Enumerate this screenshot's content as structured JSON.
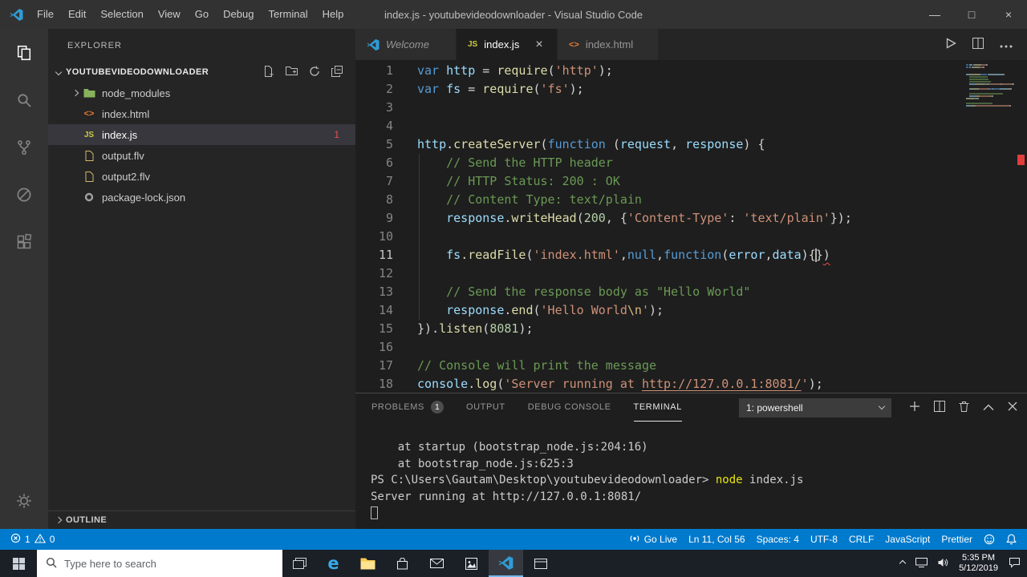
{
  "title_bar": {
    "title": "index.js - youtubevideodownloader - Visual Studio Code",
    "menus": [
      "File",
      "Edit",
      "Selection",
      "View",
      "Go",
      "Debug",
      "Terminal",
      "Help"
    ],
    "controls": {
      "minimize": "—",
      "maximize": "□",
      "close": "×"
    }
  },
  "activity_bar": {
    "views": [
      "explorer",
      "search",
      "source-control",
      "debug",
      "extensions"
    ],
    "active_view": "explorer",
    "bottom": [
      "settings"
    ]
  },
  "sidebar": {
    "title": "EXPLORER",
    "root_folder": "YOUTUBEVIDEODOWNLOADER",
    "files": [
      {
        "label": "node_modules",
        "icon": "folder",
        "chevron": true
      },
      {
        "label": "index.html",
        "icon": "html"
      },
      {
        "label": "index.js",
        "icon": "js",
        "selected": true,
        "badge": "1"
      },
      {
        "label": "output.flv",
        "icon": "file"
      },
      {
        "label": "output2.flv",
        "icon": "file"
      },
      {
        "label": "package-lock.json",
        "icon": "lock"
      }
    ],
    "outline_label": "OUTLINE"
  },
  "tabs": [
    {
      "label": "Welcome",
      "icon": "vscode",
      "preview": true
    },
    {
      "label": "index.js",
      "icon": "js",
      "active": true,
      "closable": true
    },
    {
      "label": "index.html",
      "icon": "html"
    }
  ],
  "editor": {
    "active_line": 11,
    "lines": [
      [
        [
          "kw",
          "var"
        ],
        [
          "pun",
          " "
        ],
        [
          "vr",
          "http"
        ],
        [
          "pun",
          " = "
        ],
        [
          "fn",
          "require"
        ],
        [
          "pun",
          "("
        ],
        [
          "str",
          "'http'"
        ],
        [
          "pun",
          ");"
        ]
      ],
      [
        [
          "kw",
          "var"
        ],
        [
          "pun",
          " "
        ],
        [
          "vr",
          "fs"
        ],
        [
          "pun",
          " = "
        ],
        [
          "fn",
          "require"
        ],
        [
          "pun",
          "("
        ],
        [
          "str",
          "'fs'"
        ],
        [
          "pun",
          ");"
        ]
      ],
      [],
      [],
      [
        [
          "vr",
          "http"
        ],
        [
          "pun",
          "."
        ],
        [
          "fn",
          "createServer"
        ],
        [
          "pun",
          "("
        ],
        [
          "kw",
          "function"
        ],
        [
          "pun",
          " ("
        ],
        [
          "vr",
          "request"
        ],
        [
          "pun",
          ", "
        ],
        [
          "vr",
          "response"
        ],
        [
          "pun",
          ") {"
        ]
      ],
      [
        [
          "cmt",
          "    // Send the HTTP header"
        ]
      ],
      [
        [
          "cmt",
          "    // HTTP Status: 200 : OK"
        ]
      ],
      [
        [
          "cmt",
          "    // Content Type: text/plain"
        ]
      ],
      [
        [
          "pun",
          "    "
        ],
        [
          "vr",
          "response"
        ],
        [
          "pun",
          "."
        ],
        [
          "fn",
          "writeHead"
        ],
        [
          "pun",
          "("
        ],
        [
          "num",
          "200"
        ],
        [
          "pun",
          ", {"
        ],
        [
          "str",
          "'Content-Type'"
        ],
        [
          "pun",
          ": "
        ],
        [
          "str",
          "'text/plain'"
        ],
        [
          "pun",
          "});"
        ]
      ],
      [],
      [
        [
          "pun",
          "    "
        ],
        [
          "vr",
          "fs"
        ],
        [
          "pun",
          "."
        ],
        [
          "fn",
          "readFile"
        ],
        [
          "pun",
          "("
        ],
        [
          "str",
          "'index.html'"
        ],
        [
          "pun",
          ","
        ],
        [
          "kw",
          "null"
        ],
        [
          "pun",
          ","
        ],
        [
          "kw",
          "function"
        ],
        [
          "pun",
          "("
        ],
        [
          "vr",
          "error"
        ],
        [
          "pun",
          ","
        ],
        [
          "vr",
          "data"
        ],
        [
          "pun",
          ")"
        ],
        [
          "pun",
          "{"
        ],
        [
          "caret",
          ""
        ],
        [
          "pun",
          "}"
        ],
        [
          "err",
          ")"
        ]
      ],
      [],
      [
        [
          "cmt",
          "    // Send the response body as \"Hello World\""
        ]
      ],
      [
        [
          "pun",
          "    "
        ],
        [
          "vr",
          "response"
        ],
        [
          "pun",
          "."
        ],
        [
          "fn",
          "end"
        ],
        [
          "pun",
          "("
        ],
        [
          "str",
          "'Hello World"
        ],
        [
          "esc",
          "\\n"
        ],
        [
          "str",
          "'"
        ],
        [
          "pun",
          ");"
        ]
      ],
      [
        [
          "pun",
          "})"
        ],
        [
          "pun",
          "."
        ],
        [
          "fn",
          "listen"
        ],
        [
          "pun",
          "("
        ],
        [
          "num",
          "8081"
        ],
        [
          "pun",
          ");"
        ]
      ],
      [],
      [
        [
          "cmt",
          "// Console will print the message"
        ]
      ],
      [
        [
          "vr",
          "console"
        ],
        [
          "pun",
          "."
        ],
        [
          "fn",
          "log"
        ],
        [
          "pun",
          "("
        ],
        [
          "str",
          "'Server running at "
        ],
        [
          "lnk",
          "http://127.0.0.1:8081/"
        ],
        [
          "str",
          "'"
        ],
        [
          "pun",
          ");"
        ]
      ]
    ]
  },
  "panel": {
    "tabs": [
      {
        "label": "PROBLEMS",
        "badge": "1"
      },
      {
        "label": "OUTPUT"
      },
      {
        "label": "DEBUG CONSOLE"
      },
      {
        "label": "TERMINAL",
        "active": true
      }
    ],
    "shell_selector": "1: powershell",
    "terminal": {
      "lines": [
        [
          [
            "t",
            "    at startup (bootstrap_node.js:204:16)"
          ]
        ],
        [
          [
            "t",
            "    at bootstrap_node.js:625:3"
          ]
        ],
        [
          [
            "t",
            "PS C:\\Users\\Gautam\\Desktop\\youtubevideodownloader> "
          ],
          [
            "cmd",
            "node"
          ],
          [
            "t",
            " index.js"
          ]
        ],
        [
          [
            "t",
            "Server running at http://127.0.0.1:8081/"
          ]
        ],
        [
          [
            "block",
            ""
          ]
        ]
      ]
    }
  },
  "status_bar": {
    "errors": "1",
    "warnings": "0",
    "go_live": "Go Live",
    "cursor_position": "Ln 11, Col 56",
    "indentation": "Spaces: 4",
    "encoding": "UTF-8",
    "eol": "CRLF",
    "language": "JavaScript",
    "formatter": "Prettier"
  },
  "taskbar": {
    "search_placeholder": "Type here to search",
    "apps": [
      {
        "id": "edge",
        "active": false
      },
      {
        "id": "file-explorer",
        "active": false
      },
      {
        "id": "store",
        "active": false
      },
      {
        "id": "mail",
        "active": false
      },
      {
        "id": "photos",
        "active": false
      },
      {
        "id": "vscode",
        "active": true
      },
      {
        "id": "file-explorer-2",
        "active": false
      }
    ],
    "clock": {
      "time": "5:35 PM",
      "date": "5/12/2019"
    }
  }
}
